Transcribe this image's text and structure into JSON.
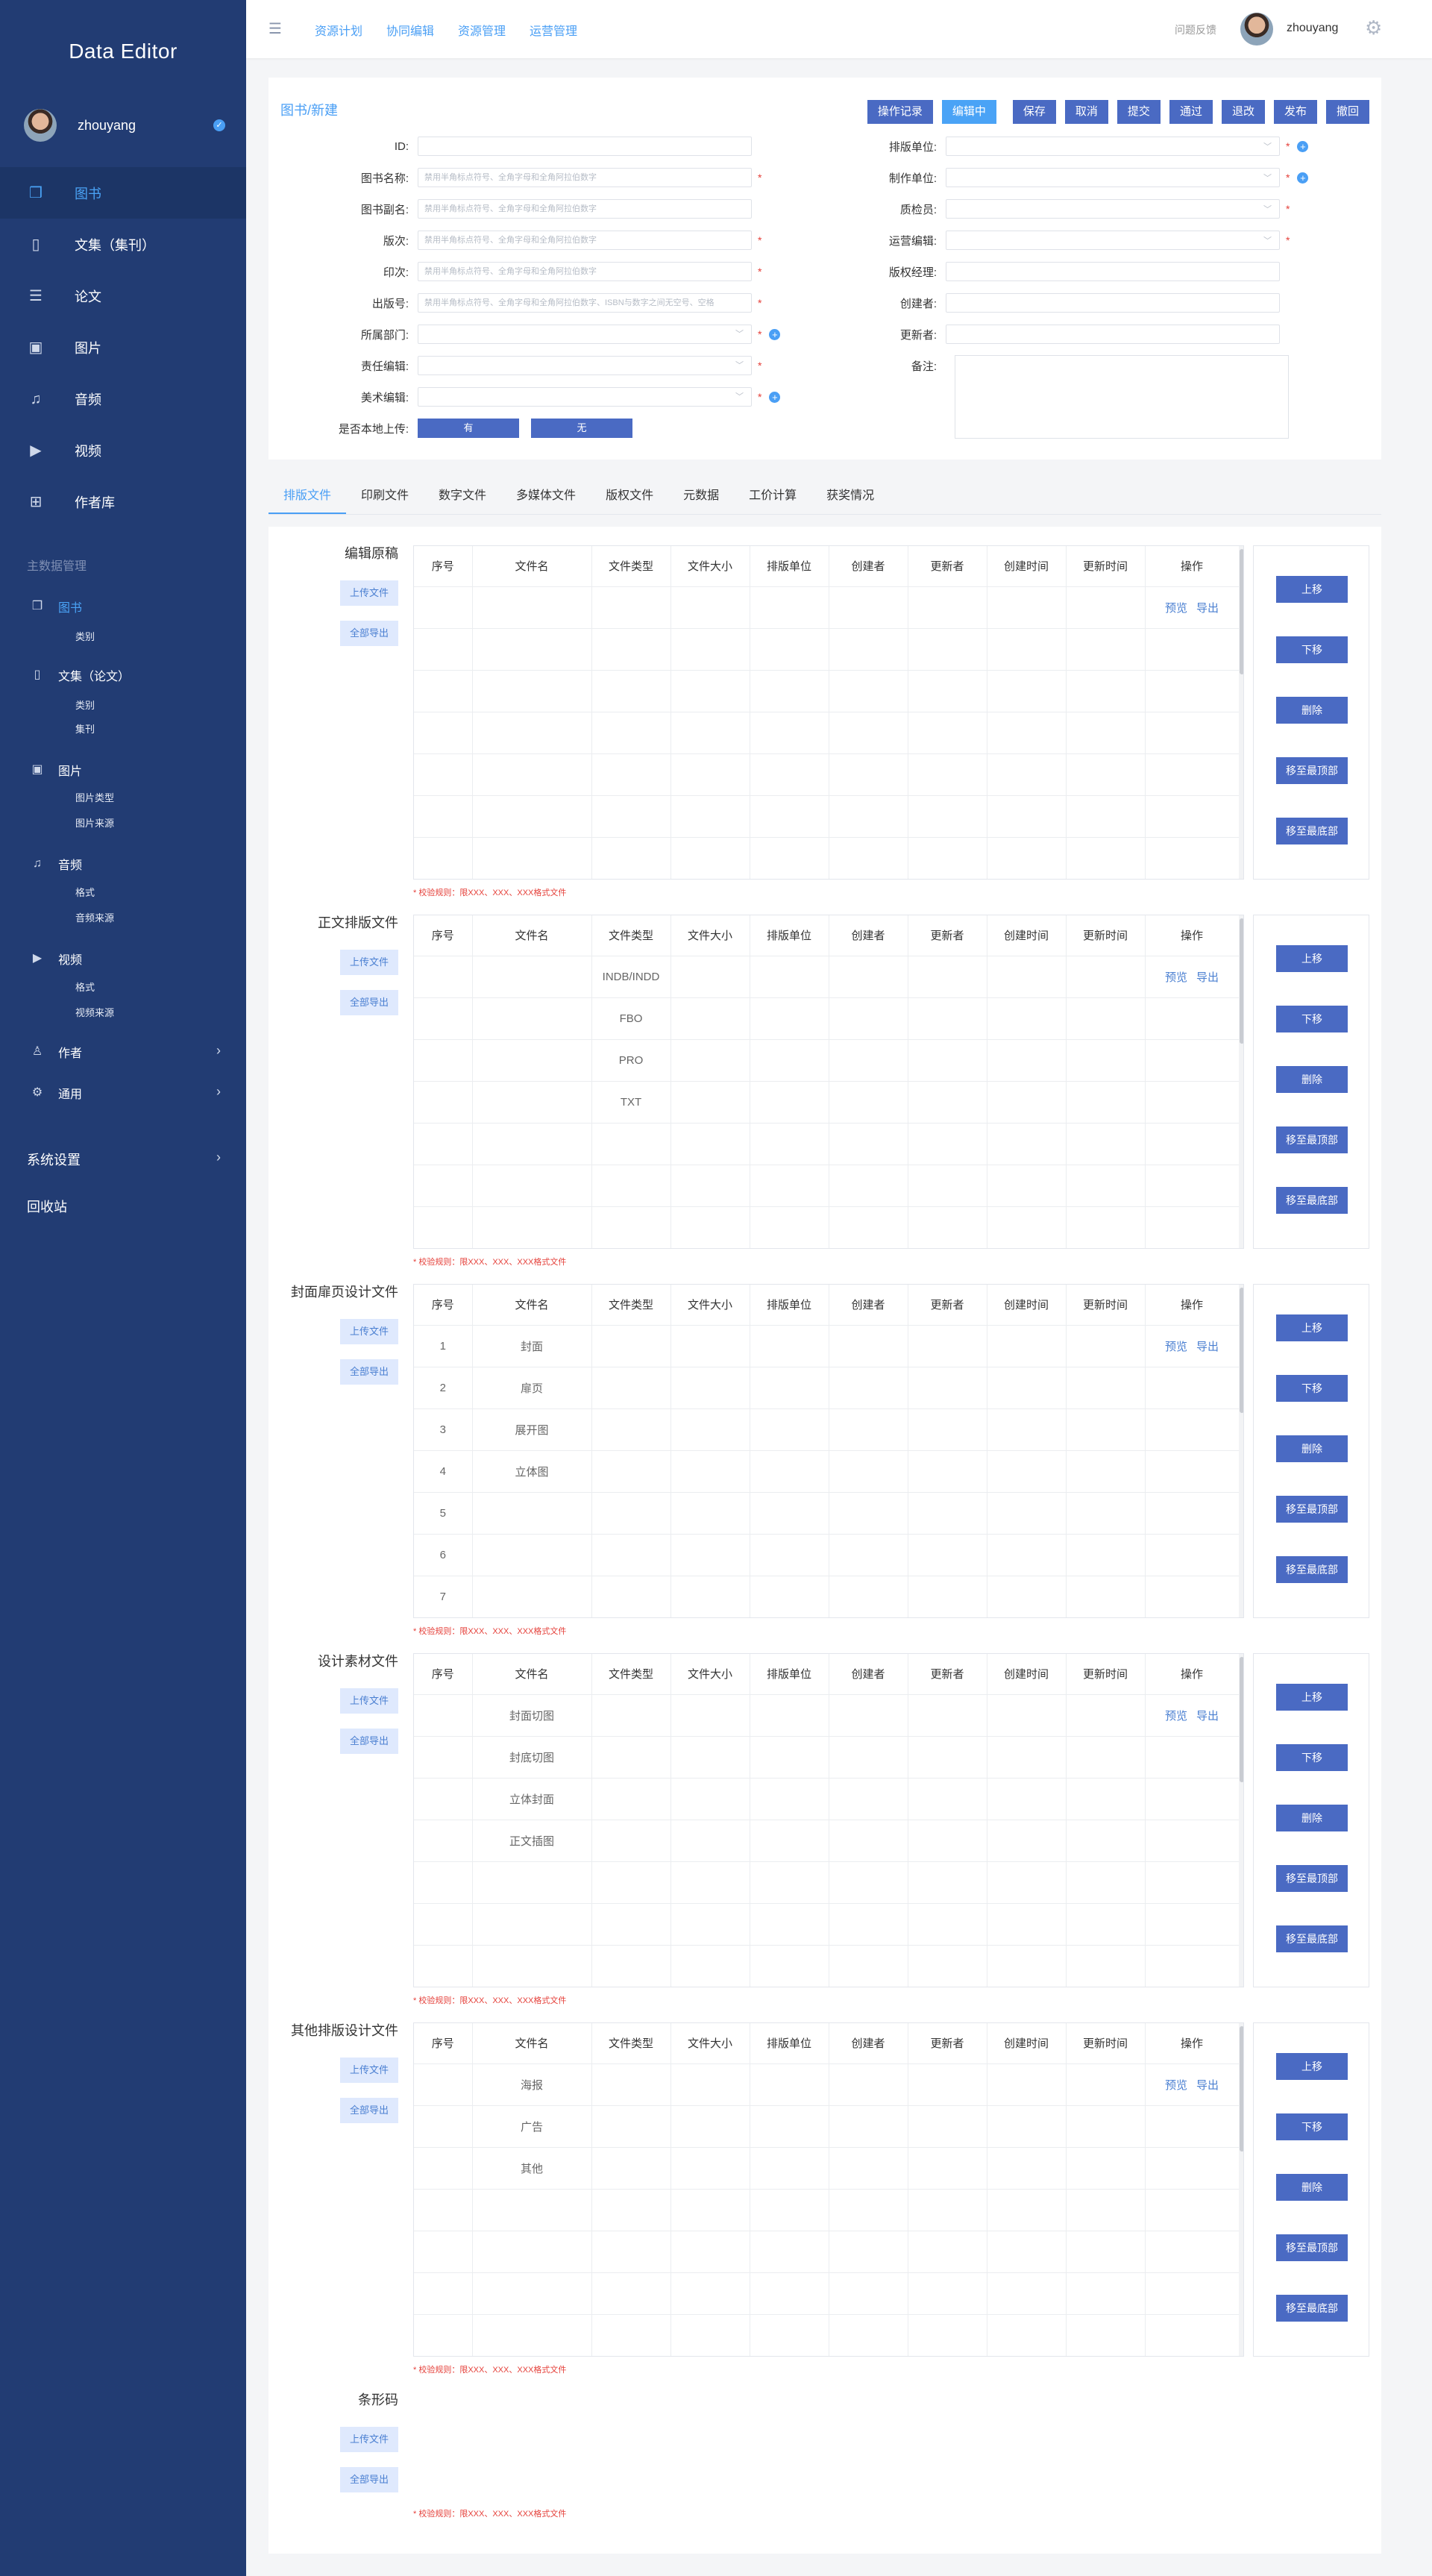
{
  "app": {
    "title": "Data Editor"
  },
  "user": {
    "name": "zhouyang"
  },
  "sidebar": {
    "items": [
      {
        "label": "图书",
        "icon": "book-icon"
      },
      {
        "label": "文集（集刊）",
        "icon": "file-icon"
      },
      {
        "label": "论文",
        "icon": "document-icon"
      },
      {
        "label": "图片",
        "icon": "image-icon"
      },
      {
        "label": "音频",
        "icon": "headphones-icon"
      },
      {
        "label": "视频",
        "icon": "video-icon"
      },
      {
        "label": "作者库",
        "icon": "grid-icon"
      }
    ],
    "section_title": "主数据管理",
    "groups": [
      {
        "label": "图书",
        "children": [
          "类别"
        ]
      },
      {
        "label": "文集（论文）",
        "children": [
          "类别",
          "集刊"
        ]
      },
      {
        "label": "图片",
        "children": [
          "图片类型",
          "图片来源"
        ]
      },
      {
        "label": "音频",
        "children": [
          "格式",
          "音频来源"
        ]
      },
      {
        "label": "视频",
        "children": [
          "格式",
          "视频来源"
        ]
      },
      {
        "label": "作者"
      },
      {
        "label": "通用"
      }
    ],
    "system": "系统设置",
    "recycle": "回收站"
  },
  "topbar": {
    "nav": [
      "资源计划",
      "协同编辑",
      "资源管理",
      "运营管理"
    ],
    "feedback": "问题反馈"
  },
  "form": {
    "breadcrumb": "图书/新建",
    "actions": [
      "操作记录",
      "编辑中",
      "保存",
      "取消",
      "提交",
      "通过",
      "退改",
      "发布",
      "撤回"
    ],
    "left_fields": [
      {
        "label": "ID:",
        "placeholder": ""
      },
      {
        "label": "图书名称:",
        "placeholder": "禁用半角标点符号、全角字母和全角阿拉伯数字"
      },
      {
        "label": "图书副名:",
        "placeholder": "禁用半角标点符号、全角字母和全角阿拉伯数字"
      },
      {
        "label": "版次:",
        "placeholder": "禁用半角标点符号、全角字母和全角阿拉伯数字"
      },
      {
        "label": "印次:",
        "placeholder": "禁用半角标点符号、全角字母和全角阿拉伯数字"
      },
      {
        "label": "出版号:",
        "placeholder": "禁用半角标点符号、全角字母和全角阿拉伯数字、ISBN与数字之间无空号、空格"
      },
      {
        "label": "所属部门:",
        "placeholder": ""
      },
      {
        "label": "责任编辑:",
        "placeholder": ""
      },
      {
        "label": "美术编辑:",
        "placeholder": ""
      }
    ],
    "local_upload": {
      "label": "是否本地上传:",
      "options": [
        "有",
        "无"
      ]
    },
    "right_fields": [
      {
        "label": "排版单位:"
      },
      {
        "label": "制作单位:"
      },
      {
        "label": "质检员:"
      },
      {
        "label": "运营编辑:"
      },
      {
        "label": "版权经理:"
      },
      {
        "label": "创建者:"
      },
      {
        "label": "更新者:"
      },
      {
        "label": "备注:"
      }
    ]
  },
  "tabs": [
    "排版文件",
    "印刷文件",
    "数字文件",
    "多媒体文件",
    "版权文件",
    "元数据",
    "工价计算",
    "获奖情况"
  ],
  "table": {
    "headers": [
      "序号",
      "文件名",
      "文件类型",
      "文件大小",
      "排版单位",
      "创建者",
      "更新者",
      "创建时间",
      "更新时间",
      "操作"
    ],
    "row_actions": [
      "预览",
      "导出"
    ]
  },
  "section_buttons": {
    "upload": "上传文件",
    "export_all": "全部导出"
  },
  "side_buttons": [
    "上移",
    "下移",
    "删除",
    "移至最顶部",
    "移至最底部"
  ],
  "rule_text": "* 校验规则：限XXX、XXX、XXX格式文件",
  "sections": [
    {
      "title": "编辑原稿",
      "rows": [
        [
          "",
          ""
        ],
        [
          "",
          ""
        ],
        [
          "",
          ""
        ],
        [
          "",
          ""
        ],
        [
          "",
          ""
        ],
        [
          "",
          ""
        ],
        [
          "",
          ""
        ]
      ]
    },
    {
      "title": "正文排版文件",
      "rows": [
        [
          "",
          "",
          "INDB/INDD"
        ],
        [
          "",
          "",
          "FBO"
        ],
        [
          "",
          "",
          "PRO"
        ],
        [
          "",
          "",
          "TXT"
        ],
        [
          "",
          ""
        ],
        [
          "",
          ""
        ],
        [
          "",
          ""
        ]
      ]
    },
    {
      "title": "封面扉页设计文件",
      "rows": [
        [
          "1",
          "封面"
        ],
        [
          "2",
          "扉页"
        ],
        [
          "3",
          "展开图"
        ],
        [
          "4",
          "立体图"
        ],
        [
          "5",
          ""
        ],
        [
          "6",
          ""
        ],
        [
          "7",
          ""
        ]
      ]
    },
    {
      "title": "设计素材文件",
      "rows": [
        [
          "",
          "封面切图"
        ],
        [
          "",
          "封底切图"
        ],
        [
          "",
          "立体封面"
        ],
        [
          "",
          "正文插图"
        ],
        [
          "",
          ""
        ],
        [
          "",
          ""
        ],
        [
          "",
          ""
        ]
      ]
    },
    {
      "title": "其他排版设计文件",
      "rows": [
        [
          "",
          "海报"
        ],
        [
          "",
          "广告"
        ],
        [
          "",
          "其他"
        ],
        [
          "",
          ""
        ],
        [
          "",
          ""
        ],
        [
          "",
          ""
        ],
        [
          "",
          ""
        ]
      ]
    },
    {
      "title": "条形码",
      "rows": []
    }
  ]
}
